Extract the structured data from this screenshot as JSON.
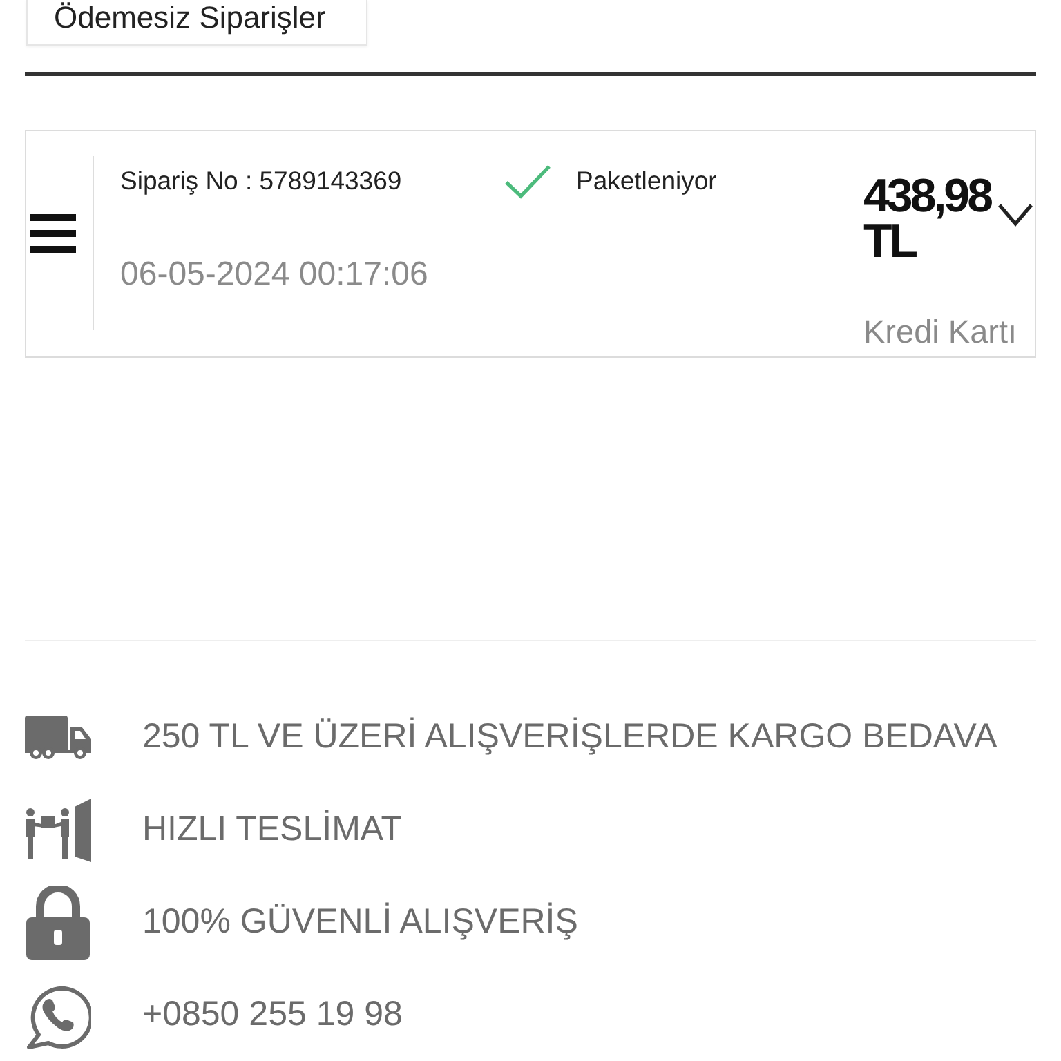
{
  "filter_button": {
    "label": "Ödemesiz Siparişler"
  },
  "orders": [
    {
      "order_no": "Sipariş No : 5789143369",
      "status": "Paketleniyor",
      "date": "06-05-2024 00:17:06",
      "total": "438,98 TL",
      "payment": "Kredi Kartı",
      "expanded": false
    }
  ],
  "features": [
    {
      "kind": "truck",
      "text": "250 TL VE ÜZERİ ALIŞVERİŞLERDE KARGO BEDAVA"
    },
    {
      "kind": "delivery",
      "text": "HIZLI TESLİMAT"
    },
    {
      "kind": "lock",
      "text": "100% GÜVENLİ ALIŞVERİŞ"
    },
    {
      "kind": "whatsapp",
      "text": "+0850 255 19 98"
    }
  ]
}
